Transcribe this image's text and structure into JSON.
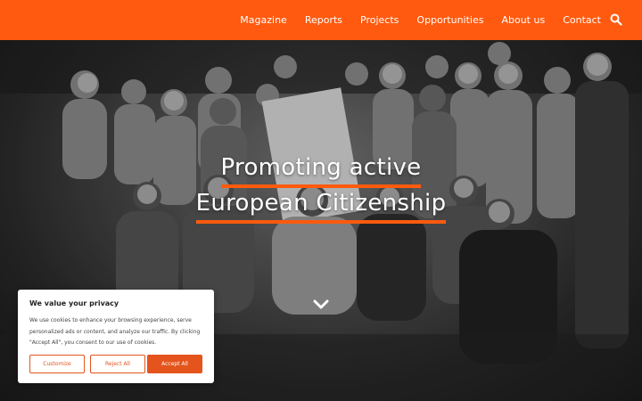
{
  "nav": {
    "items": [
      "Magazine",
      "Reports",
      "Projects",
      "Opportunities",
      "About us",
      "Contact"
    ],
    "search_icon": "search-icon",
    "color": "#ff5a0f"
  },
  "hero": {
    "headline_line1": "Promoting active",
    "headline_line2": "European Citizenship",
    "scroll_icon": "chevron-down-icon"
  },
  "cookie": {
    "title": "We value your privacy",
    "text": "We use cookies to enhance your browsing experience, serve personalized ads or content, and analyze our traffic. By clicking \"Accept All\", you consent to our use of cookies.",
    "customize_label": "Customize",
    "reject_label": "Reject All",
    "accept_label": "Accept All",
    "accent": "#e4541c"
  }
}
